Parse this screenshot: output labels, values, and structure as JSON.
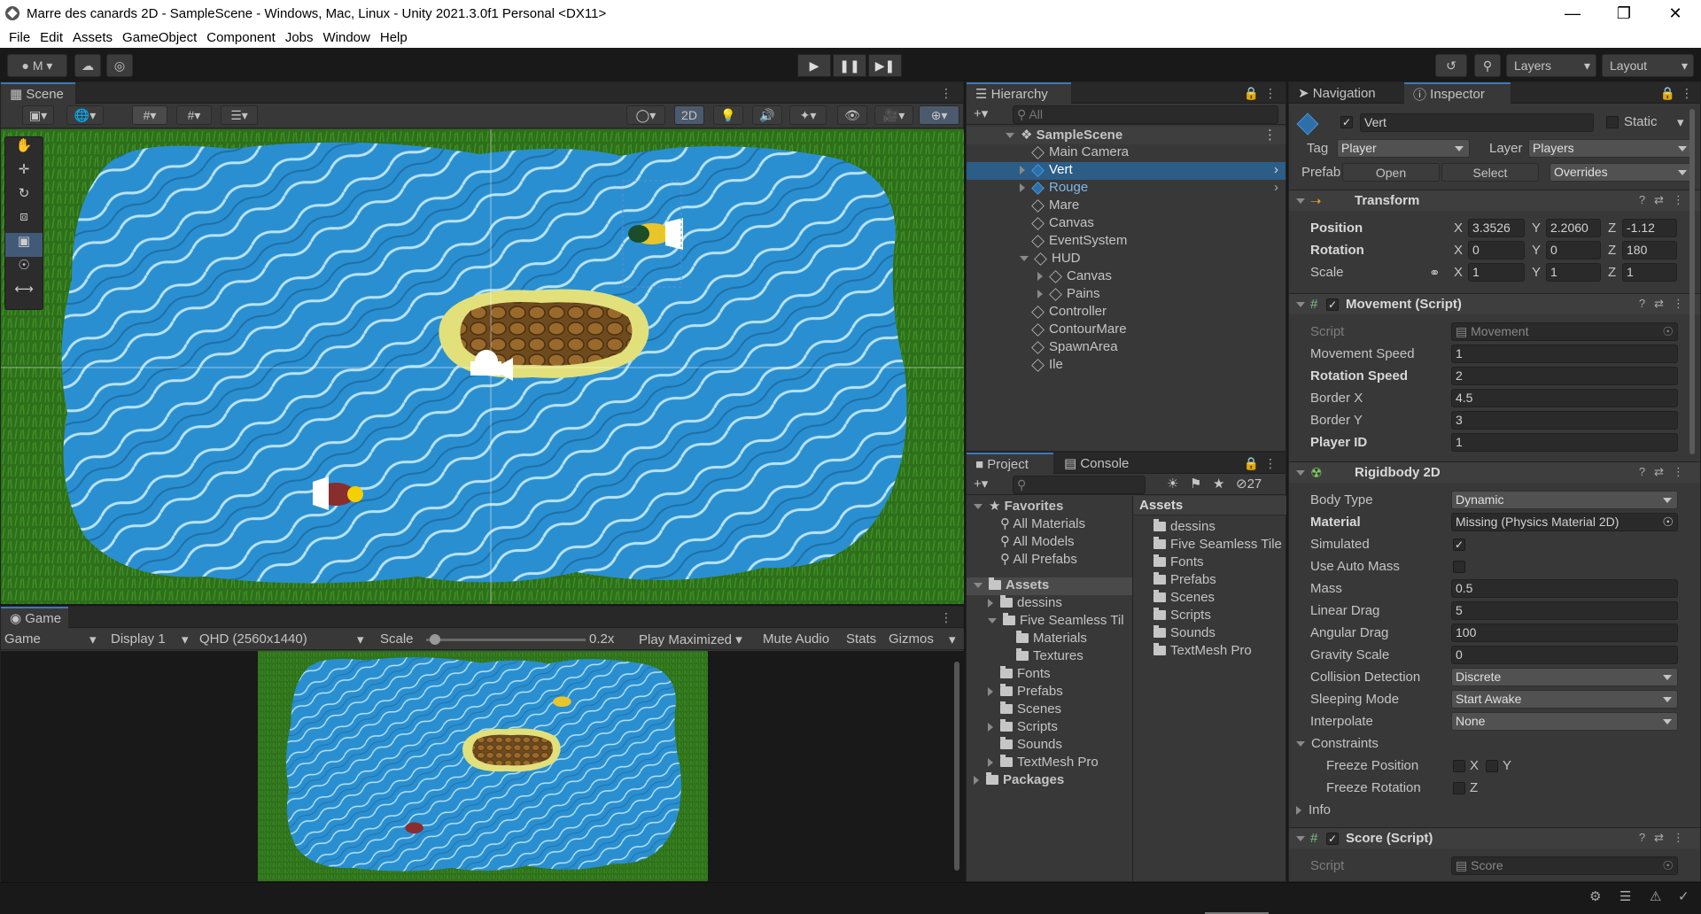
{
  "window": {
    "title": "Marre des canards 2D - SampleScene - Windows, Mac, Linux - Unity 2021.3.0f1 Personal <DX11>"
  },
  "menu": [
    "File",
    "Edit",
    "Assets",
    "GameObject",
    "Component",
    "Jobs",
    "Window",
    "Help"
  ],
  "toolbar": {
    "account": "M",
    "layers": "Layers",
    "layout": "Layout"
  },
  "scene": {
    "tab": "Scene",
    "mode2d": "2D"
  },
  "game": {
    "tab": "Game",
    "view": "Game",
    "display": "Display 1",
    "resolution": "QHD (2560x1440)",
    "scale_label": "Scale",
    "scale_value": "0.2x",
    "play_mode": "Play Maximized",
    "mute": "Mute Audio",
    "stats": "Stats",
    "gizmos": "Gizmos"
  },
  "hierarchy": {
    "tab": "Hierarchy",
    "search_placeholder": "All",
    "scene": "SampleScene",
    "items": [
      {
        "label": "Main Camera"
      },
      {
        "label": "Vert"
      },
      {
        "label": "Rouge"
      },
      {
        "label": "Mare"
      },
      {
        "label": "Canvas"
      },
      {
        "label": "EventSystem"
      },
      {
        "label": "HUD"
      },
      {
        "label": "Canvas"
      },
      {
        "label": "Pains"
      },
      {
        "label": "Controller"
      },
      {
        "label": "ContourMare"
      },
      {
        "label": "SpawnArea"
      },
      {
        "label": "Ile"
      }
    ]
  },
  "project": {
    "tab": "Project",
    "console_tab": "Console",
    "hidden_count": "27",
    "favorites": {
      "label": "Favorites",
      "items": [
        "All Materials",
        "All Models",
        "All Prefabs"
      ]
    },
    "tree": {
      "root": "Assets",
      "items": [
        "dessins",
        "Five Seamless Til",
        "Materials",
        "Textures",
        "Fonts",
        "Prefabs",
        "Scenes",
        "Scripts",
        "Sounds",
        "TextMesh Pro"
      ],
      "packages": "Packages"
    },
    "assets_header": "Assets",
    "assets": [
      "dessins",
      "Five Seamless Tile",
      "Fonts",
      "Prefabs",
      "Scenes",
      "Scripts",
      "Sounds",
      "TextMesh Pro"
    ]
  },
  "inspector": {
    "nav_tab": "Navigation",
    "tab": "Inspector",
    "name": "Vert",
    "static": "Static",
    "tag_label": "Tag",
    "tag": "Player",
    "layer_label": "Layer",
    "layer": "Players",
    "prefab_label": "Prefab",
    "open": "Open",
    "select": "Select",
    "overrides": "Overrides",
    "transform": {
      "title": "Transform",
      "position": "Position",
      "rotation": "Rotation",
      "scale": "Scale",
      "px": "3.3526",
      "py": "2.2060",
      "pz": "-1.12",
      "rx": "0",
      "ry": "0",
      "rz": "180",
      "sx": "1",
      "sy": "1",
      "sz": "1",
      "x": "X",
      "y": "Y",
      "z": "Z"
    },
    "movement": {
      "title": "Movement (Script)",
      "script_label": "Script",
      "script": "Movement",
      "rows": [
        {
          "label": "Movement Speed",
          "value": "1"
        },
        {
          "label": "Rotation Speed",
          "value": "2"
        },
        {
          "label": "Border X",
          "value": "4.5"
        },
        {
          "label": "Border Y",
          "value": "3"
        },
        {
          "label": "Player ID",
          "value": "1"
        }
      ]
    },
    "rigidbody": {
      "title": "Rigidbody 2D",
      "body_type_label": "Body Type",
      "body_type": "Dynamic",
      "material_label": "Material",
      "material": "Missing (Physics Material 2D)",
      "simulated": "Simulated",
      "auto_mass": "Use Auto Mass",
      "mass_label": "Mass",
      "mass": "0.5",
      "linear_label": "Linear Drag",
      "linear": "5",
      "angular_label": "Angular Drag",
      "angular": "100",
      "gravity_label": "Gravity Scale",
      "gravity": "0",
      "collision_label": "Collision Detection",
      "collision": "Discrete",
      "sleeping_label": "Sleeping Mode",
      "sleeping": "Start Awake",
      "interp_label": "Interpolate",
      "interp": "None",
      "constraints": "Constraints",
      "freeze_pos": "Freeze Position",
      "freeze_rot": "Freeze Rotation",
      "x": "X",
      "y": "Y",
      "z": "Z",
      "info": "Info"
    },
    "score": {
      "title": "Score (Script)",
      "script_label": "Script",
      "script": "Score"
    }
  }
}
